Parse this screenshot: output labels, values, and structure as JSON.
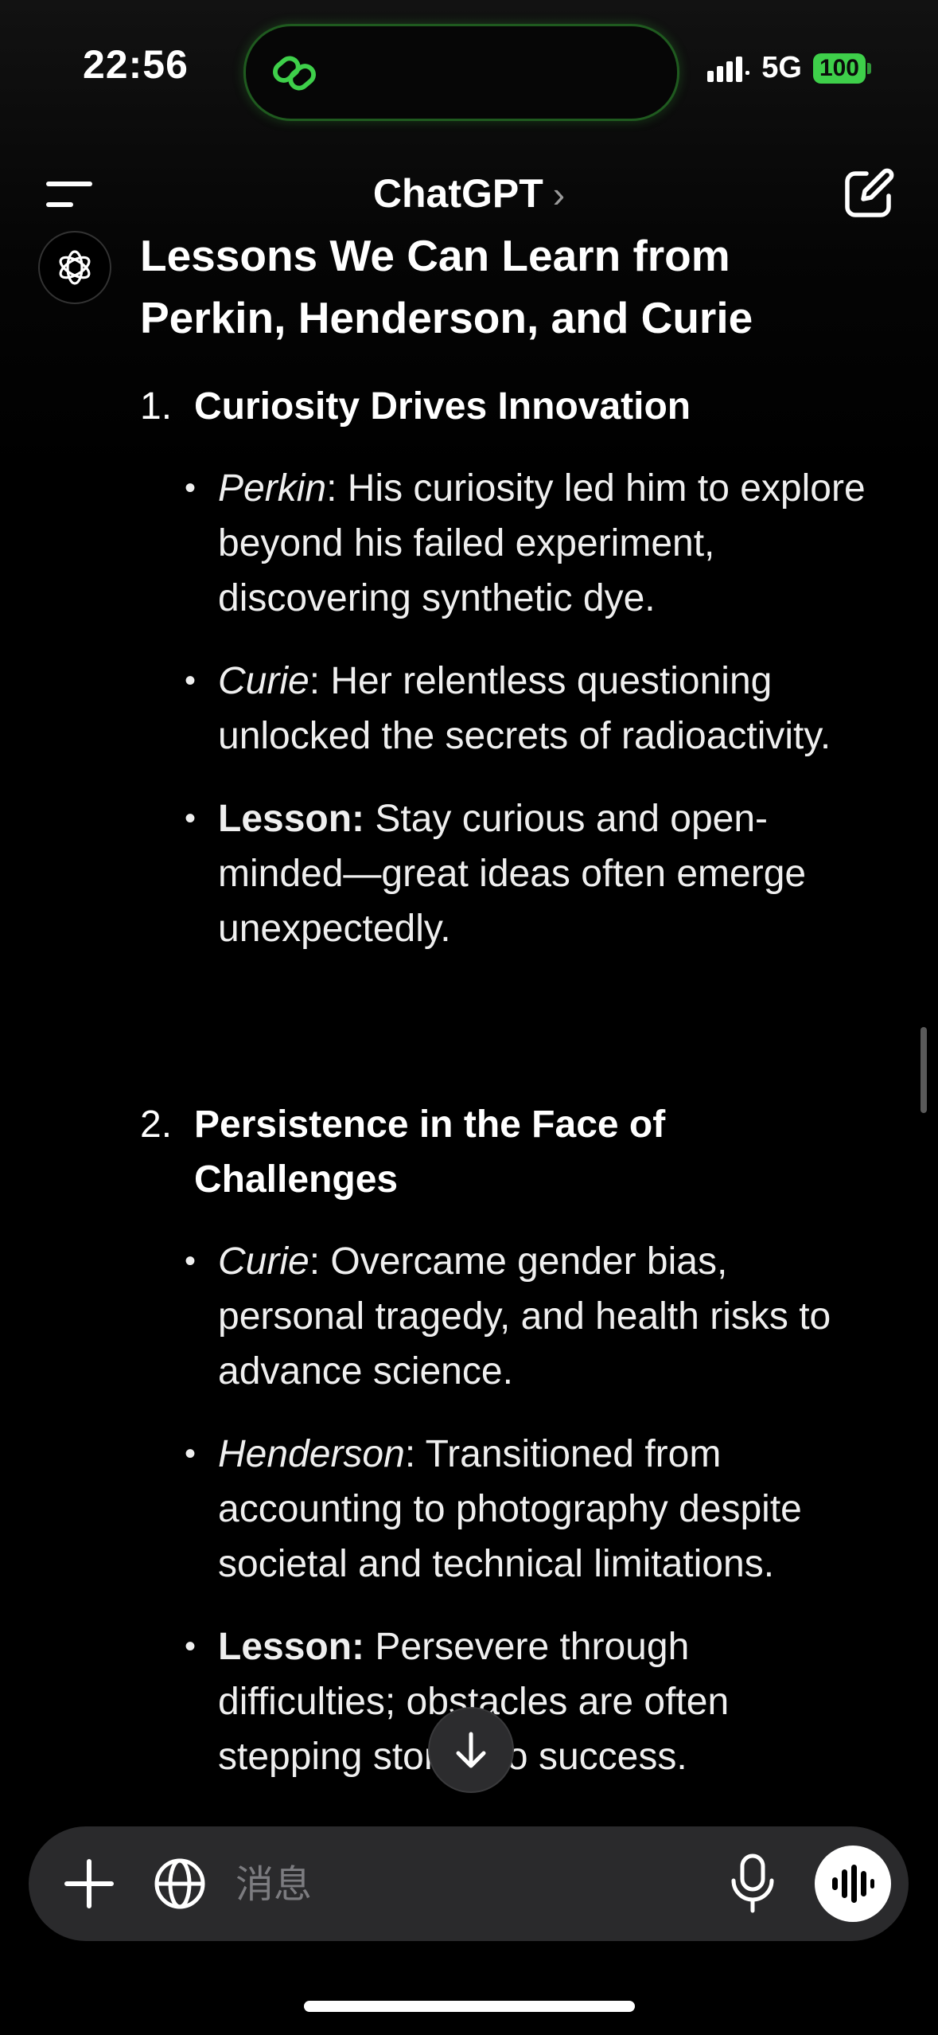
{
  "status_bar": {
    "time": "22:56",
    "network": "5G",
    "battery": "100"
  },
  "nav": {
    "title": "ChatGPT",
    "chevron": "›"
  },
  "message": {
    "heading": "Lessons We Can Learn from Perkin, Henderson, and Curie",
    "sections": [
      {
        "number": "1.",
        "title": "Curiosity Drives Innovation",
        "bullets": [
          {
            "lead": "Perkin",
            "sep": ":",
            "text": " His curiosity led him to explore beyond his failed experiment, discovering synthetic dye."
          },
          {
            "lead": "Curie",
            "sep": ":",
            "text": " Her relentless questioning unlocked the secrets of radioactivity."
          },
          {
            "lead": "Lesson:",
            "sep": "",
            "text": " Stay curious and open-minded—great ideas often emerge unexpectedly."
          }
        ]
      },
      {
        "number": "2.",
        "title": "Persistence in the Face of Challenges",
        "bullets": [
          {
            "lead": "Curie",
            "sep": ":",
            "text": " Overcame gender bias, personal tragedy, and health risks to advance science."
          },
          {
            "lead": "Henderson",
            "sep": ":",
            "text": " Transitioned from accounting to photography despite societal and technical limitations."
          },
          {
            "lead": "Lesson:",
            "sep": "",
            "text": " Persevere through difficulties; obstacles are often stepping stones to success."
          }
        ]
      }
    ]
  },
  "composer": {
    "placeholder": "消息"
  },
  "colors": {
    "background": "#000000",
    "island_glow": "#3ecf4a",
    "battery": "#3ecf4a",
    "composer": "#2a2a2c"
  },
  "icons": {
    "island": "chain-link-icon",
    "menu": "menu-icon",
    "compose": "compose-icon",
    "avatar": "openai-logo-icon",
    "scroll_down": "arrow-down-icon",
    "plus": "plus-icon",
    "globe": "globe-icon",
    "mic": "microphone-icon",
    "voice": "voice-waveform-icon"
  }
}
